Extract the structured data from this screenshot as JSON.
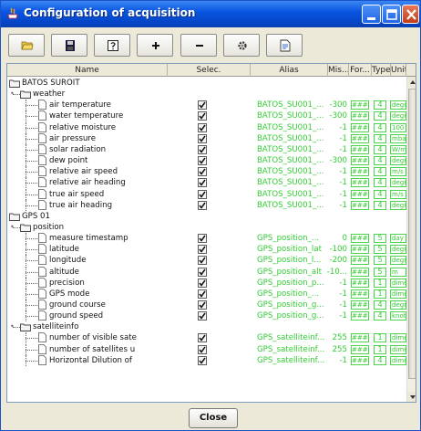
{
  "window": {
    "title": "Configuration of acquisition"
  },
  "toolbar": {
    "tools": [
      {
        "icon": "open-folder-icon"
      },
      {
        "icon": "save-disk-icon"
      },
      {
        "icon": "help-icon"
      },
      {
        "icon": "add-plus-icon"
      },
      {
        "icon": "remove-minus-icon"
      },
      {
        "icon": "settings-gear-icon"
      },
      {
        "icon": "edit-document-icon"
      }
    ]
  },
  "grid": {
    "columns": [
      "Name",
      "Selec.",
      "Alias",
      "Mis...",
      "For...",
      "Type",
      "Unit"
    ],
    "rows": [
      {
        "kind": "root",
        "label": "BATOS SUROIT"
      },
      {
        "kind": "group",
        "label": "weather"
      },
      {
        "kind": "leaf",
        "label": "air temperature",
        "checked": true,
        "alias": "BATOS_SU001_...",
        "mis": "-300",
        "fmt": "####",
        "typ": "4",
        "unit": "degr"
      },
      {
        "kind": "leaf",
        "label": "water temperature",
        "checked": true,
        "alias": "BATOS_SU001_...",
        "mis": "-300",
        "fmt": "####",
        "typ": "4",
        "unit": "degr"
      },
      {
        "kind": "leaf",
        "label": "relative moisture",
        "checked": true,
        "alias": "BATOS_SU001_...",
        "mis": "-1",
        "fmt": "####",
        "typ": "4",
        "unit": "100"
      },
      {
        "kind": "leaf",
        "label": "air pressure",
        "checked": true,
        "alias": "BATOS_SU001_...",
        "mis": "-1",
        "fmt": "####",
        "typ": "4",
        "unit": "mba"
      },
      {
        "kind": "leaf",
        "label": "solar radiation",
        "checked": true,
        "alias": "BATOS_SU001_...",
        "mis": "-1",
        "fmt": "####",
        "typ": "4",
        "unit": "W/m"
      },
      {
        "kind": "leaf",
        "label": "dew point",
        "checked": true,
        "alias": "BATOS_SU001_...",
        "mis": "-300",
        "fmt": "####",
        "typ": "4",
        "unit": "degr"
      },
      {
        "kind": "leaf",
        "label": "relative air speed",
        "checked": true,
        "alias": "BATOS_SU001_...",
        "mis": "-1",
        "fmt": "####",
        "typ": "4",
        "unit": "m/s"
      },
      {
        "kind": "leaf",
        "label": "relative air heading",
        "checked": true,
        "alias": "BATOS_SU001_...",
        "mis": "-1",
        "fmt": "####",
        "typ": "4",
        "unit": "degr"
      },
      {
        "kind": "leaf",
        "label": "true air speed",
        "checked": true,
        "alias": "BATOS_SU001_...",
        "mis": "-1",
        "fmt": "####",
        "typ": "4",
        "unit": "m/s"
      },
      {
        "kind": "leaf",
        "label": "true air heading",
        "checked": true,
        "alias": "BATOS_SU001_...",
        "mis": "-1",
        "fmt": "####",
        "typ": "4",
        "unit": "degr"
      },
      {
        "kind": "root",
        "label": "GPS 01"
      },
      {
        "kind": "group",
        "label": "position"
      },
      {
        "kind": "leaf",
        "label": "measure timestamp",
        "checked": true,
        "alias": "GPS_position_...",
        "mis": "0",
        "fmt": "####",
        "typ": "5",
        "unit": "day"
      },
      {
        "kind": "leaf",
        "label": "latitude",
        "checked": true,
        "alias": "GPS_position_lat",
        "mis": "-100",
        "fmt": "####",
        "typ": "5",
        "unit": "degr"
      },
      {
        "kind": "leaf",
        "label": "longitude",
        "checked": true,
        "alias": "GPS_position_l...",
        "mis": "-200",
        "fmt": "####",
        "typ": "5",
        "unit": "degr"
      },
      {
        "kind": "leaf",
        "label": "altitude",
        "checked": true,
        "alias": "GPS_position_alt",
        "mis": "-10...",
        "fmt": "####",
        "typ": "5",
        "unit": "m"
      },
      {
        "kind": "leaf",
        "label": "precision",
        "checked": true,
        "alias": "GPS_position_p...",
        "mis": "-1",
        "fmt": "####",
        "typ": "1",
        "unit": "dime"
      },
      {
        "kind": "leaf",
        "label": "GPS mode",
        "checked": true,
        "alias": "GPS_position_...",
        "mis": "-1",
        "fmt": "####",
        "typ": "1",
        "unit": "dime"
      },
      {
        "kind": "leaf",
        "label": "ground course",
        "checked": true,
        "alias": "GPS_position_g...",
        "mis": "-1",
        "fmt": "####",
        "typ": "4",
        "unit": "degr"
      },
      {
        "kind": "leaf",
        "label": "ground speed",
        "checked": true,
        "alias": "GPS_position_g...",
        "mis": "-1",
        "fmt": "####",
        "typ": "4",
        "unit": "knot"
      },
      {
        "kind": "group",
        "label": "satelliteinfo"
      },
      {
        "kind": "leaf",
        "label": "number of visible sate",
        "checked": true,
        "alias": "GPS_satelliteinf...",
        "mis": "255",
        "fmt": "####",
        "typ": "1",
        "unit": "dime"
      },
      {
        "kind": "leaf",
        "label": "number of satellites u",
        "checked": true,
        "alias": "GPS_satelliteinf...",
        "mis": "255",
        "fmt": "####",
        "typ": "1",
        "unit": "dime"
      },
      {
        "kind": "leaf",
        "label": "Horizontal Dilution of",
        "checked": true,
        "alias": "GPS_satelliteinf...",
        "mis": "-1",
        "fmt": "####",
        "typ": "4",
        "unit": "dime"
      }
    ]
  },
  "footer": {
    "close_label": "Close"
  },
  "colors": {
    "titlebar": "#0a55e0",
    "alias_text": "#33cc33"
  }
}
